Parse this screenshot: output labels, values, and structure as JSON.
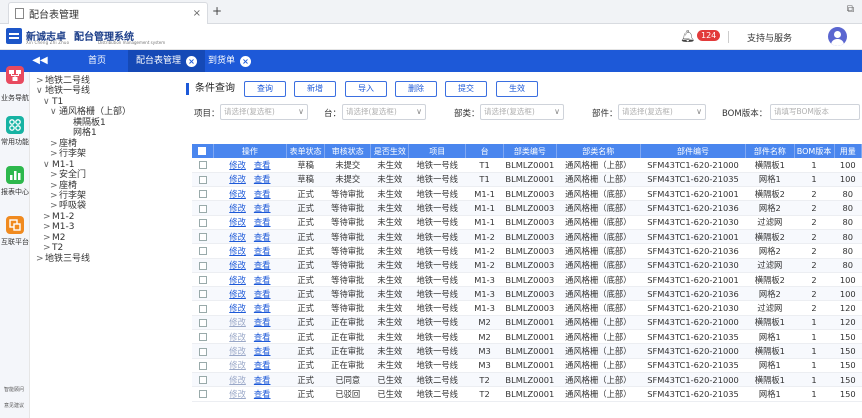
{
  "browser": {
    "tab_title": "配台表管理",
    "tab_close": "×",
    "new_tab": "+",
    "win_btn": "⧉"
  },
  "header": {
    "brand_name": "新诚志卓",
    "brand_sub": "Xin Cheng Zhi Zhuo",
    "system_name": "配台管理系统",
    "system_sub": "Distribution management system",
    "notification_count": "124",
    "support_label": "支持与服务"
  },
  "nav": {
    "collapse_label": "◀◀",
    "tabs": [
      {
        "label": "首页",
        "closable": false
      },
      {
        "label": "配台表管理",
        "closable": true
      },
      {
        "label": "到货单",
        "closable": true
      }
    ]
  },
  "leftnav": {
    "items": [
      {
        "label": "",
        "icon": "org-chart-icon",
        "color": "#e84a5f"
      },
      {
        "label": "业务导航",
        "icon": "",
        "color": ""
      },
      {
        "label": "常用功能",
        "icon": "grid-icon",
        "color": "#17b3a3"
      },
      {
        "label": "报表中心",
        "icon": "bar-chart-icon",
        "color": "#2db84d"
      },
      {
        "label": "互联平台",
        "icon": "connect-icon",
        "color": "#f08a1f"
      }
    ],
    "bottom": [
      "智能顾问",
      "意见建议"
    ]
  },
  "tree": [
    {
      "label": "地铁二号线",
      "arrow": ">",
      "level": 0
    },
    {
      "label": "地铁一号线",
      "arrow": "∨",
      "level": 0
    },
    {
      "label": "T1",
      "arrow": "∨",
      "level": 1
    },
    {
      "label": "通风格栅（上部）",
      "arrow": "∨",
      "level": 2
    },
    {
      "label": "横隔板1",
      "arrow": "",
      "level": 4
    },
    {
      "label": "网格1",
      "arrow": "",
      "level": 4
    },
    {
      "label": "座椅",
      "arrow": ">",
      "level": 2
    },
    {
      "label": "行李架",
      "arrow": ">",
      "level": 2
    },
    {
      "label": "M1-1",
      "arrow": "∨",
      "level": 1
    },
    {
      "label": "安全门",
      "arrow": ">",
      "level": 2
    },
    {
      "label": "座椅",
      "arrow": ">",
      "level": 2
    },
    {
      "label": "行李架",
      "arrow": ">",
      "level": 2
    },
    {
      "label": "呼吸袋",
      "arrow": ">",
      "level": 2
    },
    {
      "label": "M1-2",
      "arrow": ">",
      "level": 1
    },
    {
      "label": "M1-3",
      "arrow": ">",
      "level": 1
    },
    {
      "label": "M2",
      "arrow": ">",
      "level": 1
    },
    {
      "label": "T2",
      "arrow": ">",
      "level": 1
    },
    {
      "label": "地铁三号线",
      "arrow": ">",
      "level": 0
    }
  ],
  "query": {
    "title": "条件查询",
    "buttons": [
      "查询",
      "新增",
      "导入",
      "删除",
      "提交",
      "生效"
    ],
    "filters": [
      {
        "label": "项目：",
        "placeholder": "请选择(复选框)"
      },
      {
        "label": "台：",
        "placeholder": "请选择(复选框)"
      },
      {
        "label": "部类：",
        "placeholder": "请选择(复选框)"
      },
      {
        "label": "部件：",
        "placeholder": "请选择(复选框)"
      },
      {
        "label": "BOM版本：",
        "placeholder": "请填写BOM版本"
      }
    ]
  },
  "table": {
    "headers": [
      "",
      "操作",
      "表单状态",
      "审核状态",
      "是否生效",
      "项目",
      "台",
      "部类编号",
      "部类名称",
      "部件编号",
      "部件名称",
      "BOM版本",
      "用量"
    ],
    "edit_label": "修改",
    "view_label": "查看",
    "rows": [
      {
        "edit_enabled": true,
        "cells": [
          "草稿",
          "未提交",
          "未生效",
          "地铁一号线",
          "T1",
          "BLMLZ0001",
          "通风格栅（上部）",
          "SFM43TC1-620-21000",
          "横隔板1",
          "1",
          "100"
        ]
      },
      {
        "edit_enabled": true,
        "cells": [
          "草稿",
          "未提交",
          "未生效",
          "地铁一号线",
          "T1",
          "BLMLZ0001",
          "通风格栅（上部）",
          "SFM43TC1-620-21035",
          "网格1",
          "1",
          "100"
        ]
      },
      {
        "edit_enabled": true,
        "cells": [
          "正式",
          "等待审批",
          "未生效",
          "地铁一号线",
          "M1-1",
          "BLMLZ0003",
          "通风格栅（底部）",
          "SFM43TC1-620-21001",
          "横隔板2",
          "2",
          "80"
        ]
      },
      {
        "edit_enabled": true,
        "cells": [
          "正式",
          "等待审批",
          "未生效",
          "地铁一号线",
          "M1-1",
          "BLMLZ0003",
          "通风格栅（底部）",
          "SFM43TC1-620-21036",
          "网格2",
          "2",
          "80"
        ]
      },
      {
        "edit_enabled": true,
        "cells": [
          "正式",
          "等待审批",
          "未生效",
          "地铁一号线",
          "M1-1",
          "BLMLZ0003",
          "通风格栅（底部）",
          "SFM43TC1-620-21030",
          "过滤网",
          "2",
          "80"
        ]
      },
      {
        "edit_enabled": true,
        "cells": [
          "正式",
          "等待审批",
          "未生效",
          "地铁一号线",
          "M1-2",
          "BLMLZ0003",
          "通风格栅（底部）",
          "SFM43TC1-620-21001",
          "横隔板2",
          "2",
          "80"
        ]
      },
      {
        "edit_enabled": true,
        "cells": [
          "正式",
          "等待审批",
          "未生效",
          "地铁一号线",
          "M1-2",
          "BLMLZ0003",
          "通风格栅（底部）",
          "SFM43TC1-620-21036",
          "网格2",
          "2",
          "80"
        ]
      },
      {
        "edit_enabled": true,
        "cells": [
          "正式",
          "等待审批",
          "未生效",
          "地铁一号线",
          "M1-2",
          "BLMLZ0003",
          "通风格栅（底部）",
          "SFM43TC1-620-21030",
          "过滤网",
          "2",
          "80"
        ]
      },
      {
        "edit_enabled": true,
        "cells": [
          "正式",
          "等待审批",
          "未生效",
          "地铁一号线",
          "M1-3",
          "BLMLZ0003",
          "通风格栅（底部）",
          "SFM43TC1-620-21001",
          "横隔板2",
          "2",
          "100"
        ]
      },
      {
        "edit_enabled": true,
        "cells": [
          "正式",
          "等待审批",
          "未生效",
          "地铁一号线",
          "M1-3",
          "BLMLZ0003",
          "通风格栅（底部）",
          "SFM43TC1-620-21036",
          "网格2",
          "2",
          "100"
        ]
      },
      {
        "edit_enabled": true,
        "cells": [
          "正式",
          "等待审批",
          "未生效",
          "地铁一号线",
          "M1-3",
          "BLMLZ0003",
          "通风格栅（底部）",
          "SFM43TC1-620-21030",
          "过滤网",
          "2",
          "120"
        ]
      },
      {
        "edit_enabled": false,
        "cells": [
          "正式",
          "正在审批",
          "未生效",
          "地铁一号线",
          "M2",
          "BLMLZ0001",
          "通风格栅（上部）",
          "SFM43TC1-620-21000",
          "横隔板1",
          "1",
          "120"
        ]
      },
      {
        "edit_enabled": false,
        "cells": [
          "正式",
          "正在审批",
          "未生效",
          "地铁一号线",
          "M2",
          "BLMLZ0001",
          "通风格栅（上部）",
          "SFM43TC1-620-21035",
          "网格1",
          "1",
          "150"
        ]
      },
      {
        "edit_enabled": false,
        "cells": [
          "正式",
          "正在审批",
          "未生效",
          "地铁一号线",
          "M3",
          "BLMLZ0001",
          "通风格栅（上部）",
          "SFM43TC1-620-21000",
          "横隔板1",
          "1",
          "150"
        ]
      },
      {
        "edit_enabled": false,
        "cells": [
          "正式",
          "正在审批",
          "未生效",
          "地铁一号线",
          "M3",
          "BLMLZ0001",
          "通风格栅（上部）",
          "SFM43TC1-620-21035",
          "网格1",
          "1",
          "150"
        ]
      },
      {
        "edit_enabled": false,
        "cells": [
          "正式",
          "已同意",
          "已生效",
          "地铁二号线",
          "T2",
          "BLMLZ0001",
          "通风格栅（上部）",
          "SFM43TC1-620-21000",
          "横隔板1",
          "1",
          "150"
        ]
      },
      {
        "edit_enabled": false,
        "cells": [
          "正式",
          "已驳回",
          "已生效",
          "地铁二号线",
          "T2",
          "BLMLZ0001",
          "通风格栅（上部）",
          "SFM43TC1-620-21035",
          "网格1",
          "1",
          "150"
        ]
      }
    ]
  }
}
